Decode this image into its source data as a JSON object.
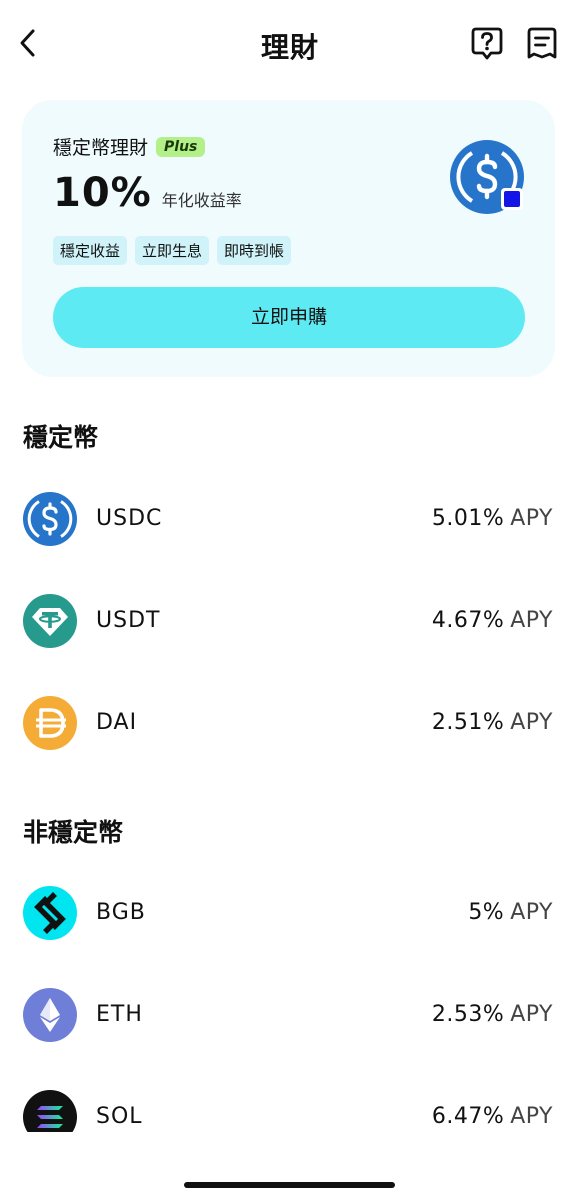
{
  "header": {
    "title": "理財",
    "back_icon": "chevron-left-icon",
    "help_icon": "question-bubble-icon",
    "orders_icon": "order-list-icon"
  },
  "promo": {
    "title": "穩定幣理財",
    "badge": "Plus",
    "rate": "10%",
    "rate_label": "年化收益率",
    "tags": [
      "穩定收益",
      "立即生息",
      "即時到帳"
    ],
    "cta": "立即申購",
    "coin_icon": "usdc-icon",
    "background_color": "#f0fbfd",
    "cta_color": "#5eeaf3"
  },
  "sections": {
    "stable": {
      "title": "穩定幣",
      "items": [
        {
          "symbol": "USDC",
          "rate": "5.01%",
          "unit": "APY",
          "icon": "usdc-icon",
          "color": "#2775ca"
        },
        {
          "symbol": "USDT",
          "rate": "4.67%",
          "unit": "APY",
          "icon": "tether-icon",
          "color": "#279a8e"
        },
        {
          "symbol": "DAI",
          "rate": "2.51%",
          "unit": "APY",
          "icon": "dai-icon",
          "color": "#f5ac37"
        }
      ]
    },
    "non_stable": {
      "title": "非穩定幣",
      "items": [
        {
          "symbol": "BGB",
          "rate": "5%",
          "unit": "APY",
          "icon": "bitget-icon",
          "color": "#00e5f0"
        },
        {
          "symbol": "ETH",
          "rate": "2.53%",
          "unit": "APY",
          "icon": "ethereum-icon",
          "color": "#6f7fd8"
        },
        {
          "symbol": "SOL",
          "rate": "6.47%",
          "unit": "APY",
          "icon": "solana-icon",
          "color": "#111111"
        }
      ]
    }
  }
}
